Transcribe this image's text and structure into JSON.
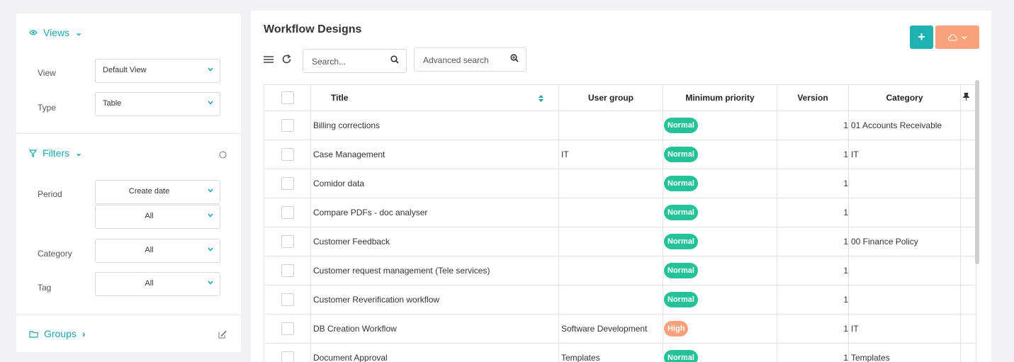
{
  "sidebar": {
    "views": {
      "label": "Views"
    },
    "view": {
      "label": "View",
      "value": "Default View"
    },
    "type": {
      "label": "Type",
      "value": "Table"
    },
    "filters": {
      "label": "Filters"
    },
    "period": {
      "label": "Period",
      "value1": "Create date",
      "value2": "All"
    },
    "category": {
      "label": "Category",
      "value": "All"
    },
    "tag": {
      "label": "Tag",
      "value": "All"
    },
    "groups": {
      "label": "Groups"
    }
  },
  "main": {
    "title": "Workflow Designs",
    "search_placeholder": "Search...",
    "advanced_search": "Advanced search",
    "add_button": "+"
  },
  "table": {
    "headers": {
      "title": "Title",
      "user_group": "User group",
      "min_priority": "Minimum priority",
      "version": "Version",
      "category": "Category"
    },
    "rows": [
      {
        "title": "Billing corrections",
        "user_group": "",
        "priority": "Normal",
        "version": "1",
        "category": "01 Accounts Receivable"
      },
      {
        "title": "Case Management",
        "user_group": "IT",
        "priority": "Normal",
        "version": "1",
        "category": "IT"
      },
      {
        "title": "Comidor data",
        "user_group": "",
        "priority": "Normal",
        "version": "1",
        "category": ""
      },
      {
        "title": "Compare PDFs - doc analyser",
        "user_group": "",
        "priority": "Normal",
        "version": "1",
        "category": ""
      },
      {
        "title": "Customer Feedback",
        "user_group": "",
        "priority": "Normal",
        "version": "1",
        "category": "00 Finance Policy"
      },
      {
        "title": "Customer request management (Tele services)",
        "user_group": "",
        "priority": "Normal",
        "version": "1",
        "category": ""
      },
      {
        "title": "Customer Reverification workflow",
        "user_group": "",
        "priority": "Normal",
        "version": "1",
        "category": ""
      },
      {
        "title": "DB Creation Workflow",
        "user_group": "Software Development",
        "priority": "High",
        "version": "1",
        "category": "IT"
      },
      {
        "title": "Document Approval",
        "user_group": "Templates",
        "priority": "Normal",
        "version": "1",
        "category": "Templates"
      }
    ]
  },
  "colors": {
    "accent": "#1fa7b0",
    "normal": "#25c29a",
    "high": "#f9a27c",
    "add_button": "#1fb2b0"
  }
}
